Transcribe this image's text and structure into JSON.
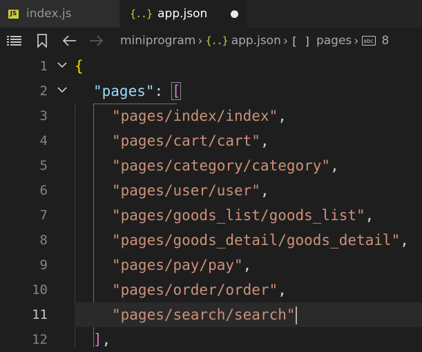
{
  "tabs": [
    {
      "icon": "JS",
      "label": "index.js"
    },
    {
      "icon": "{..}",
      "label": "app.json"
    }
  ],
  "breadcrumb": {
    "items": [
      {
        "label": "miniprogram"
      },
      {
        "icon": "{..}",
        "label": "app.json"
      },
      {
        "icon": "[ ]",
        "label": "pages"
      },
      {
        "icon": "abc",
        "label": "8"
      }
    ]
  },
  "editor": {
    "lines": [
      {
        "number": "1",
        "brace": "{"
      },
      {
        "number": "2",
        "key": "\"pages\"",
        "colon": ": ",
        "bracket": "["
      },
      {
        "number": "3",
        "value": "\"pages/index/index\"",
        "comma": ","
      },
      {
        "number": "4",
        "value": "\"pages/cart/cart\"",
        "comma": ","
      },
      {
        "number": "5",
        "value": "\"pages/category/category\"",
        "comma": ","
      },
      {
        "number": "6",
        "value": "\"pages/user/user\"",
        "comma": ","
      },
      {
        "number": "7",
        "value": "\"pages/goods_list/goods_list\"",
        "comma": ","
      },
      {
        "number": "8",
        "value": "\"pages/goods_detail/goods_detail\"",
        "comma": ","
      },
      {
        "number": "9",
        "value": "\"pages/pay/pay\"",
        "comma": ","
      },
      {
        "number": "10",
        "value": "\"pages/order/order\"",
        "comma": ","
      },
      {
        "number": "11",
        "value": "\"pages/search/search\"",
        "comma": ""
      },
      {
        "number": "12",
        "bracket": "]",
        "comma": ","
      }
    ]
  },
  "colors": {
    "background": "#1e1e1e",
    "string": "#ce9178",
    "key": "#9cdcfe",
    "brace": "#ffd700",
    "bracket": "#da70d6"
  }
}
